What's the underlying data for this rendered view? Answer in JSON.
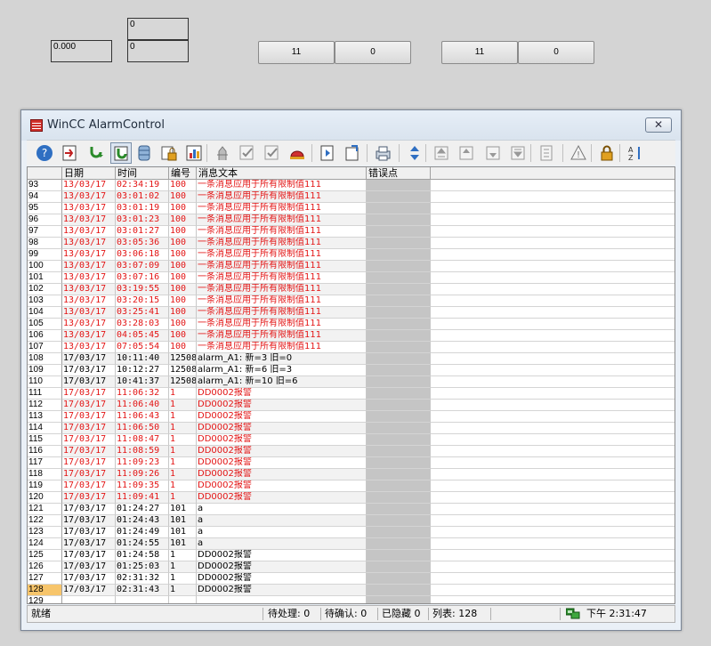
{
  "top_fields": {
    "field_top": "0",
    "field_left": "0.000",
    "field_right": "0"
  },
  "button_pairs": [
    {
      "left": "11",
      "right": "0"
    },
    {
      "left": "11",
      "right": "0"
    }
  ],
  "window": {
    "title": "WinCC AlarmControl",
    "close_glyph": "✕"
  },
  "toolbar": {
    "icons": [
      "help-icon",
      "emergency-list-icon",
      "acknowledge-icon",
      "group-acknowledge-icon",
      "archive-list-icon",
      "lock-list-icon",
      "statistics-icon",
      "loop-in-alarm-icon",
      "checkmark-icon",
      "checkmark-icon",
      "alarm-horn-icon",
      "report-icon",
      "info-icon",
      "print-icon",
      "sort-icon",
      "first-message-icon",
      "previous-message-icon",
      "next-message-icon",
      "last-message-icon",
      "properties-icon",
      "warning-icon",
      "lock-icon",
      "sort-az-icon"
    ]
  },
  "columns": {
    "date": "日期",
    "time": "时间",
    "number": "编号",
    "message": "消息文本",
    "error_point": "错误点"
  },
  "rows": [
    {
      "n": "93",
      "date": "13/03/17",
      "time": "02:34:19",
      "num": "100",
      "msg": "一条消息应用于所有限制值111",
      "red": true
    },
    {
      "n": "94",
      "date": "13/03/17",
      "time": "03:01:02",
      "num": "100",
      "msg": "一条消息应用于所有限制值111",
      "red": true
    },
    {
      "n": "95",
      "date": "13/03/17",
      "time": "03:01:19",
      "num": "100",
      "msg": "一条消息应用于所有限制值111",
      "red": true
    },
    {
      "n": "96",
      "date": "13/03/17",
      "time": "03:01:23",
      "num": "100",
      "msg": "一条消息应用于所有限制值111",
      "red": true
    },
    {
      "n": "97",
      "date": "13/03/17",
      "time": "03:01:27",
      "num": "100",
      "msg": "一条消息应用于所有限制值111",
      "red": true
    },
    {
      "n": "98",
      "date": "13/03/17",
      "time": "03:05:36",
      "num": "100",
      "msg": "一条消息应用于所有限制值111",
      "red": true
    },
    {
      "n": "99",
      "date": "13/03/17",
      "time": "03:06:18",
      "num": "100",
      "msg": "一条消息应用于所有限制值111",
      "red": true
    },
    {
      "n": "100",
      "date": "13/03/17",
      "time": "03:07:09",
      "num": "100",
      "msg": "一条消息应用于所有限制值111",
      "red": true
    },
    {
      "n": "101",
      "date": "13/03/17",
      "time": "03:07:16",
      "num": "100",
      "msg": "一条消息应用于所有限制值111",
      "red": true
    },
    {
      "n": "102",
      "date": "13/03/17",
      "time": "03:19:55",
      "num": "100",
      "msg": "一条消息应用于所有限制值111",
      "red": true
    },
    {
      "n": "103",
      "date": "13/03/17",
      "time": "03:20:15",
      "num": "100",
      "msg": "一条消息应用于所有限制值111",
      "red": true
    },
    {
      "n": "104",
      "date": "13/03/17",
      "time": "03:25:41",
      "num": "100",
      "msg": "一条消息应用于所有限制值111",
      "red": true
    },
    {
      "n": "105",
      "date": "13/03/17",
      "time": "03:28:03",
      "num": "100",
      "msg": "一条消息应用于所有限制值111",
      "red": true
    },
    {
      "n": "106",
      "date": "13/03/17",
      "time": "04:05:45",
      "num": "100",
      "msg": "一条消息应用于所有限制值111",
      "red": true
    },
    {
      "n": "107",
      "date": "13/03/17",
      "time": "07:05:54",
      "num": "100",
      "msg": "一条消息应用于所有限制值111",
      "red": true
    },
    {
      "n": "108",
      "date": "17/03/17",
      "time": "10:11:40",
      "num": "12508",
      "msg": "alarm_A1:    新=3   旧=0",
      "red": false
    },
    {
      "n": "109",
      "date": "17/03/17",
      "time": "10:12:27",
      "num": "12508",
      "msg": "alarm_A1:    新=6   旧=3",
      "red": false
    },
    {
      "n": "110",
      "date": "17/03/17",
      "time": "10:41:37",
      "num": "12508",
      "msg": "alarm_A1:    新=10  旧=6",
      "red": false
    },
    {
      "n": "111",
      "date": "17/03/17",
      "time": "11:06:32",
      "num": "1",
      "msg": "DD0002报警",
      "red": true
    },
    {
      "n": "112",
      "date": "17/03/17",
      "time": "11:06:40",
      "num": "1",
      "msg": "DD0002报警",
      "red": true
    },
    {
      "n": "113",
      "date": "17/03/17",
      "time": "11:06:43",
      "num": "1",
      "msg": "DD0002报警",
      "red": true
    },
    {
      "n": "114",
      "date": "17/03/17",
      "time": "11:06:50",
      "num": "1",
      "msg": "DD0002报警",
      "red": true
    },
    {
      "n": "115",
      "date": "17/03/17",
      "time": "11:08:47",
      "num": "1",
      "msg": "DD0002报警",
      "red": true
    },
    {
      "n": "116",
      "date": "17/03/17",
      "time": "11:08:59",
      "num": "1",
      "msg": "DD0002报警",
      "red": true
    },
    {
      "n": "117",
      "date": "17/03/17",
      "time": "11:09:23",
      "num": "1",
      "msg": "DD0002报警",
      "red": true
    },
    {
      "n": "118",
      "date": "17/03/17",
      "time": "11:09:26",
      "num": "1",
      "msg": "DD0002报警",
      "red": true
    },
    {
      "n": "119",
      "date": "17/03/17",
      "time": "11:09:35",
      "num": "1",
      "msg": "DD0002报警",
      "red": true
    },
    {
      "n": "120",
      "date": "17/03/17",
      "time": "11:09:41",
      "num": "1",
      "msg": "DD0002报警",
      "red": true
    },
    {
      "n": "121",
      "date": "17/03/17",
      "time": "01:24:27",
      "num": "101",
      "msg": "a",
      "red": false
    },
    {
      "n": "122",
      "date": "17/03/17",
      "time": "01:24:43",
      "num": "101",
      "msg": "a",
      "red": false
    },
    {
      "n": "123",
      "date": "17/03/17",
      "time": "01:24:49",
      "num": "101",
      "msg": "a",
      "red": false
    },
    {
      "n": "124",
      "date": "17/03/17",
      "time": "01:24:55",
      "num": "101",
      "msg": "a",
      "red": false
    },
    {
      "n": "125",
      "date": "17/03/17",
      "time": "01:24:58",
      "num": "1",
      "msg": "DD0002报警",
      "red": false
    },
    {
      "n": "126",
      "date": "17/03/17",
      "time": "01:25:03",
      "num": "1",
      "msg": "DD0002报警",
      "red": false
    },
    {
      "n": "127",
      "date": "17/03/17",
      "time": "02:31:32",
      "num": "1",
      "msg": "DD0002报警",
      "red": false
    },
    {
      "n": "128",
      "date": "17/03/17",
      "time": "02:31:43",
      "num": "1",
      "msg": "DD0002报警",
      "red": false,
      "selected": true
    },
    {
      "n": "129",
      "date": "",
      "time": "",
      "num": "",
      "msg": "",
      "red": false
    }
  ],
  "status": {
    "ready": "就绪",
    "pending": "待处理: 0",
    "to_ack": "待确认: 0",
    "hidden": "已隐藏 0",
    "list": "列表: 128",
    "clock": "下午 2:31:47"
  }
}
